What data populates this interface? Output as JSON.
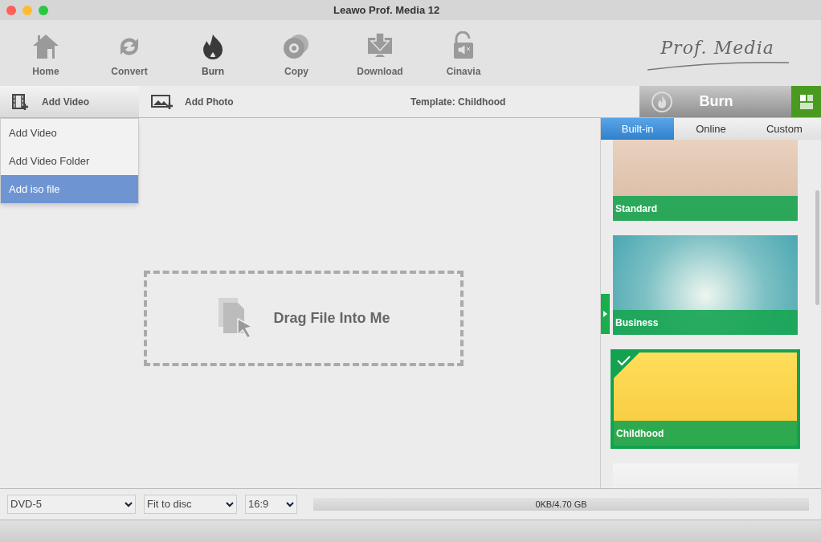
{
  "window": {
    "title": "Leawo Prof. Media 12"
  },
  "toolbar": [
    {
      "label": "Home",
      "selected": false
    },
    {
      "label": "Convert",
      "selected": false
    },
    {
      "label": "Burn",
      "selected": true
    },
    {
      "label": "Copy",
      "selected": false
    },
    {
      "label": "Download",
      "selected": false
    },
    {
      "label": "Cinavia",
      "selected": false
    }
  ],
  "logo": "Prof. Media",
  "action_bar": {
    "add_video": "Add Video",
    "add_photo": "Add Photo",
    "template_label": "Template: Childhood",
    "burn_button": "Burn"
  },
  "add_video_menu": [
    {
      "label": "Add Video",
      "selected": false
    },
    {
      "label": "Add Video Folder",
      "selected": false
    },
    {
      "label": "Add iso file",
      "selected": true
    }
  ],
  "drop_zone": {
    "text": "Drag File Into Me"
  },
  "template_tabs": [
    {
      "label": "Built-in",
      "selected": true
    },
    {
      "label": "Online",
      "selected": false
    },
    {
      "label": "Custom",
      "selected": false
    }
  ],
  "templates": [
    {
      "label": "Standard",
      "selected": false
    },
    {
      "label": "Business",
      "selected": false
    },
    {
      "label": "Childhood",
      "selected": true
    },
    {
      "selected": false
    }
  ],
  "bottom_bar": {
    "disc_type": "DVD-5",
    "fit": "Fit to disc",
    "aspect": "16:9",
    "capacity": {
      "text": "0KB/4.70 GB"
    }
  }
}
